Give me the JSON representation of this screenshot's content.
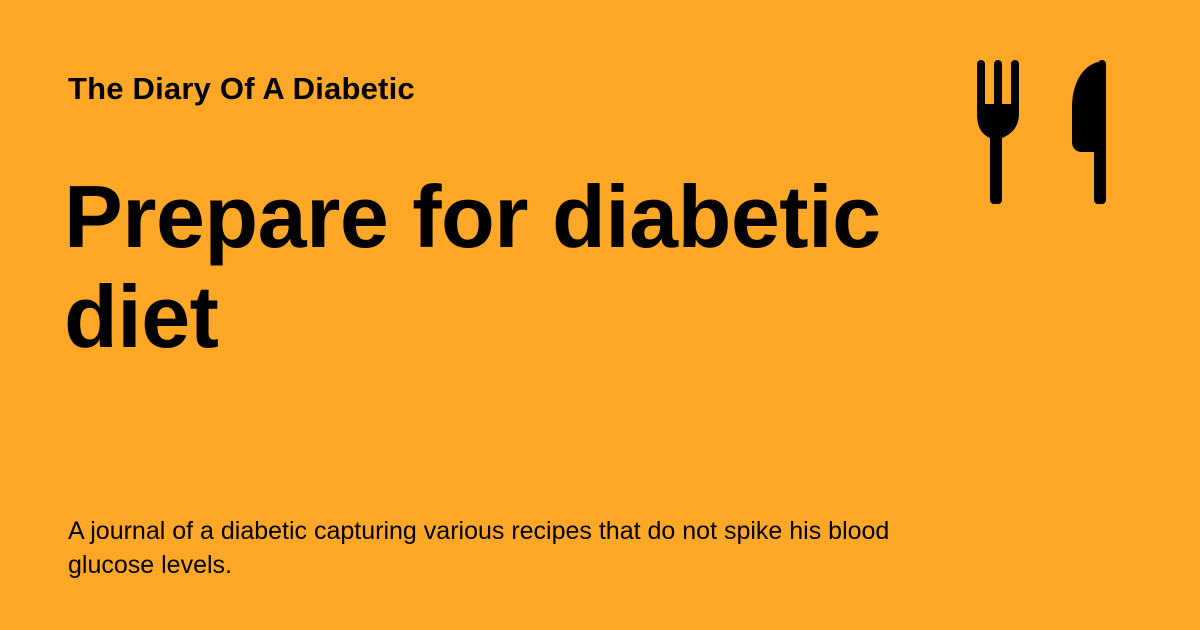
{
  "card": {
    "site_name": "The Diary Of A Diabetic",
    "title": "Prepare for diabetic diet",
    "description": "A journal of a diabetic capturing various recipes that do not spike his blood glucose levels.",
    "icon": "fork-knife-icon",
    "background_color": "#FFA726",
    "text_color": "#000000"
  }
}
